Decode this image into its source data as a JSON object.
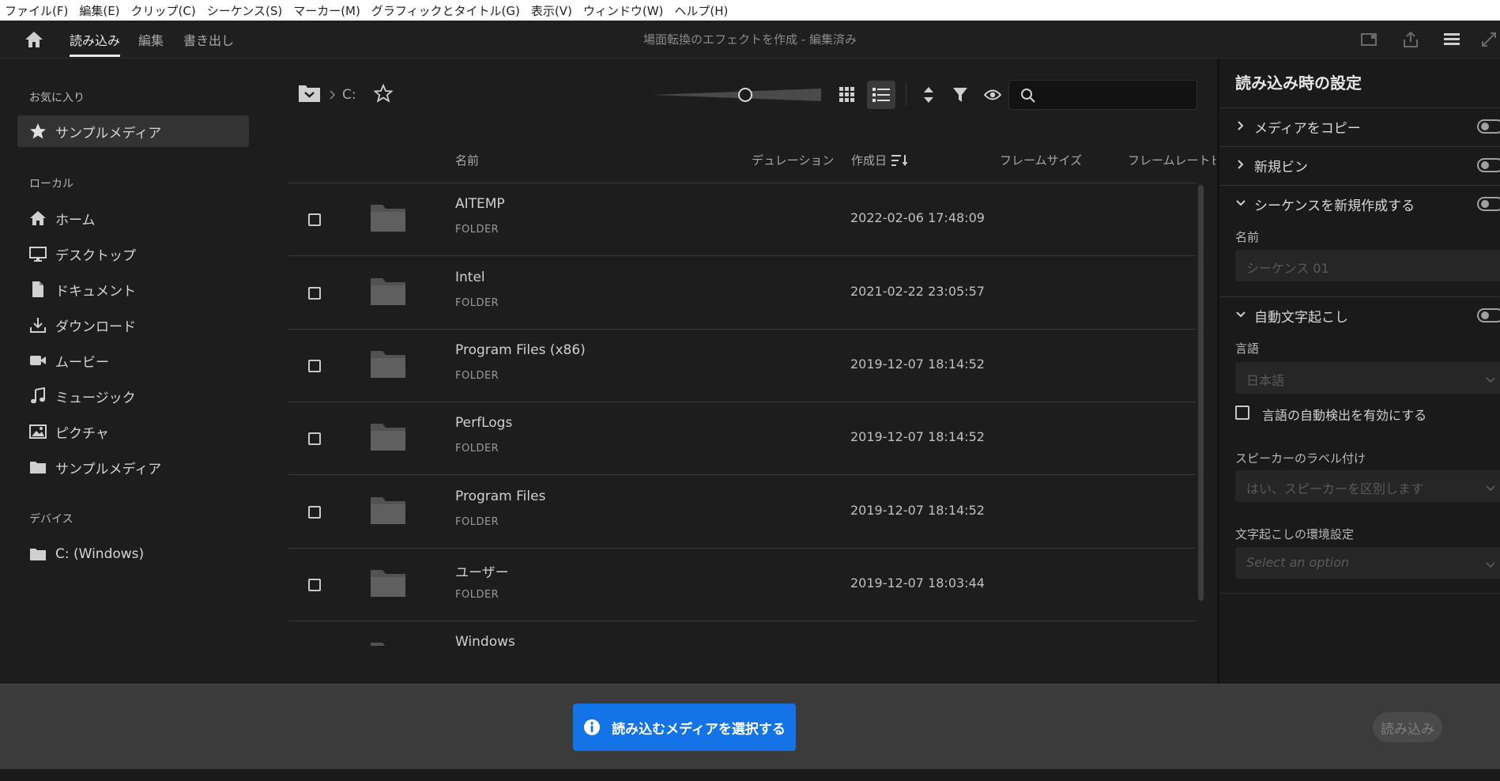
{
  "menubar": [
    "ファイル(F)",
    "編集(E)",
    "クリップ(C)",
    "シーケンス(S)",
    "マーカー(M)",
    "グラフィックとタイトル(G)",
    "表示(V)",
    "ウィンドウ(W)",
    "ヘルプ(H)"
  ],
  "appbar": {
    "tabs": [
      "読み込み",
      "編集",
      "書き出し"
    ],
    "active_tab": "読み込み",
    "title": "場面転換のエフェクトを作成 - 編集済み"
  },
  "sidebar": {
    "favorites_title": "お気に入り",
    "favorites": [
      {
        "label": "サンプルメディア",
        "icon": "star-icon"
      }
    ],
    "local_title": "ローカル",
    "local": [
      {
        "label": "ホーム",
        "icon": "home-icon"
      },
      {
        "label": "デスクトップ",
        "icon": "monitor-icon"
      },
      {
        "label": "ドキュメント",
        "icon": "document-icon"
      },
      {
        "label": "ダウンロード",
        "icon": "download-icon"
      },
      {
        "label": "ムービー",
        "icon": "camera-icon"
      },
      {
        "label": "ミュージック",
        "icon": "music-icon"
      },
      {
        "label": "ピクチャ",
        "icon": "picture-icon"
      },
      {
        "label": "サンプルメディア",
        "icon": "folder-icon"
      }
    ],
    "devices_title": "デバイス",
    "devices": [
      {
        "label": "C: (Windows)",
        "icon": "folder-icon"
      }
    ]
  },
  "browser": {
    "path": "C:",
    "columns": {
      "name": "名前",
      "duration": "デュレーション",
      "created": "作成日",
      "frame_size": "フレームサイズ",
      "frame_rate": "フレームレート",
      "extra": "ビ"
    },
    "rows": [
      {
        "name": "AITEMP",
        "type": "FOLDER",
        "date": "2022-02-06 17:48:09"
      },
      {
        "name": "Intel",
        "type": "FOLDER",
        "date": "2021-02-22 23:05:57"
      },
      {
        "name": "Program Files (x86)",
        "type": "FOLDER",
        "date": "2019-12-07 18:14:52"
      },
      {
        "name": "PerfLogs",
        "type": "FOLDER",
        "date": "2019-12-07 18:14:52"
      },
      {
        "name": "Program Files",
        "type": "FOLDER",
        "date": "2019-12-07 18:14:52"
      },
      {
        "name": "ユーザー",
        "type": "FOLDER",
        "date": "2019-12-07 18:03:44"
      },
      {
        "name": "Windows",
        "type": "FOLDER",
        "date": ""
      }
    ]
  },
  "settings": {
    "title": "読み込み時の設定",
    "copy_media": "メディアをコピー",
    "new_bin": "新規ビン",
    "new_sequence": "シーケンスを新規作成する",
    "name_label": "名前",
    "name_placeholder": "シーケンス 01",
    "auto_transcribe": "自動文字起こし",
    "language_label": "言語",
    "language_value": "日本語",
    "auto_detect": "言語の自動検出を有効にする",
    "speaker_label": "スピーカーのラベル付け",
    "speaker_value": "はい、スピーカーを区別します",
    "pref_label": "文字起こしの環境設定",
    "pref_value": "Select an option"
  },
  "bottom": {
    "select_media": "読み込むメディアを選択する",
    "import": "読み込み"
  },
  "colors": {
    "accent": "#1473e6",
    "background": "#1d1d1d",
    "panel": "#1a1a1a"
  }
}
